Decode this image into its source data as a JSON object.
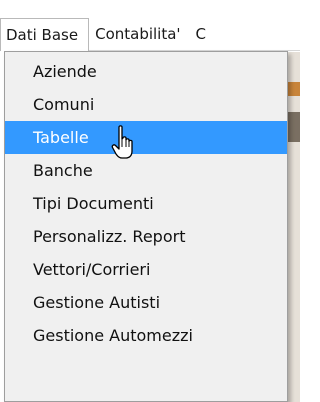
{
  "menubar": {
    "items": [
      {
        "label": "Dati Base",
        "active": true
      },
      {
        "label": "Contabilita'",
        "active": false
      },
      {
        "label": "C",
        "active": false
      }
    ]
  },
  "dropdown": {
    "items": [
      {
        "label": "Aziende"
      },
      {
        "label": "Comuni"
      },
      {
        "label": "Tabelle",
        "highlighted": true
      },
      {
        "label": "Banche"
      },
      {
        "label": "Tipi Documenti"
      },
      {
        "label": "Personalizz. Report"
      },
      {
        "label": "Vettori/Corrieri"
      },
      {
        "label": "Gestione Autisti"
      },
      {
        "label": "Gestione Automezzi"
      }
    ]
  },
  "colors": {
    "highlight": "#3399ff",
    "menu_bg": "#f0f0f0"
  },
  "cursor": {
    "icon": "hand-pointer-icon"
  }
}
